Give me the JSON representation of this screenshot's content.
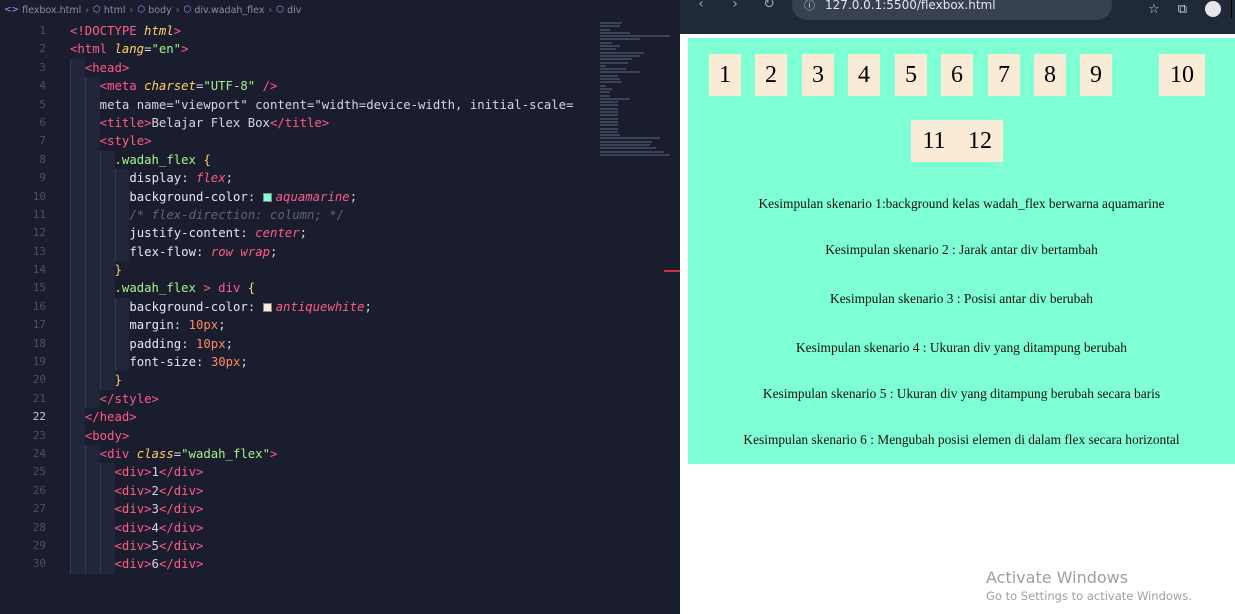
{
  "editor": {
    "breadcrumb": [
      "flexbox.html",
      "html",
      "body",
      "div.wadah_flex",
      "div"
    ],
    "lines": [
      {
        "n": "1",
        "t": "<!DOCTYPE html>"
      },
      {
        "n": "2",
        "t": "<html lang=\"en\">"
      },
      {
        "n": "3",
        "t": "<head>"
      },
      {
        "n": "4",
        "t": "<meta charset=\"UTF-8\" />"
      },
      {
        "n": "5",
        "t": "<meta name=\"viewport\" content=\"width=device-width, initial-scale="
      },
      {
        "n": "6",
        "t": "<title>Belajar Flex Box</title>"
      },
      {
        "n": "7",
        "t": "<style>"
      },
      {
        "n": "8",
        "t": ".wadah_flex {"
      },
      {
        "n": "9",
        "t": "display: flex;"
      },
      {
        "n": "10",
        "t": "background-color: aquamarine;"
      },
      {
        "n": "11",
        "t": "/* flex-direction: column; */"
      },
      {
        "n": "12",
        "t": "justify-content: center;"
      },
      {
        "n": "13",
        "t": "flex-flow: row wrap;"
      },
      {
        "n": "14",
        "t": "}"
      },
      {
        "n": "15",
        "t": ".wadah_flex > div {"
      },
      {
        "n": "16",
        "t": "background-color: antiquewhite;"
      },
      {
        "n": "17",
        "t": "margin: 10px;"
      },
      {
        "n": "18",
        "t": "padding: 10px;"
      },
      {
        "n": "19",
        "t": "font-size: 30px;"
      },
      {
        "n": "20",
        "t": "}"
      },
      {
        "n": "21",
        "t": "</style>"
      },
      {
        "n": "22",
        "t": "</head>"
      },
      {
        "n": "23",
        "t": "<body>"
      },
      {
        "n": "24",
        "t": "<div class=\"wadah_flex\">"
      },
      {
        "n": "25",
        "t": "<div>1</div>"
      },
      {
        "n": "26",
        "t": "<div>2</div>"
      },
      {
        "n": "27",
        "t": "<div>3</div>"
      },
      {
        "n": "28",
        "t": "<div>4</div>"
      },
      {
        "n": "29",
        "t": "<div>5</div>"
      },
      {
        "n": "30",
        "t": "<div>6</div>"
      }
    ]
  },
  "browser": {
    "address": "127.0.0.1:5500/flexbox.html",
    "flex_items": [
      "1",
      "2",
      "3",
      "4",
      "5",
      "6",
      "7",
      "8",
      "9",
      "10",
      "11",
      "12"
    ],
    "conclusions": [
      "Kesimpulan skenario 1:background kelas wadah_flex berwarna aquamarine",
      "Kesimpulan skenario 2 : Jarak antar div bertambah",
      "Kesimpulan skenario 3 : Posisi antar div berubah",
      "Kesimpulan skenario 4 : Ukuran div yang ditampung berubah",
      "Kesimpulan skenario 5 : Ukuran div yang ditampung berubah secara baris",
      "Kesimpulan skenario 6 : Mengubah posisi elemen di dalam flex secara horizontal"
    ],
    "colors": {
      "container": "#7fffd4",
      "item": "#faebd7"
    }
  },
  "watermark": {
    "title": "Activate Windows",
    "subtitle": "Go to Settings to activate Windows."
  }
}
